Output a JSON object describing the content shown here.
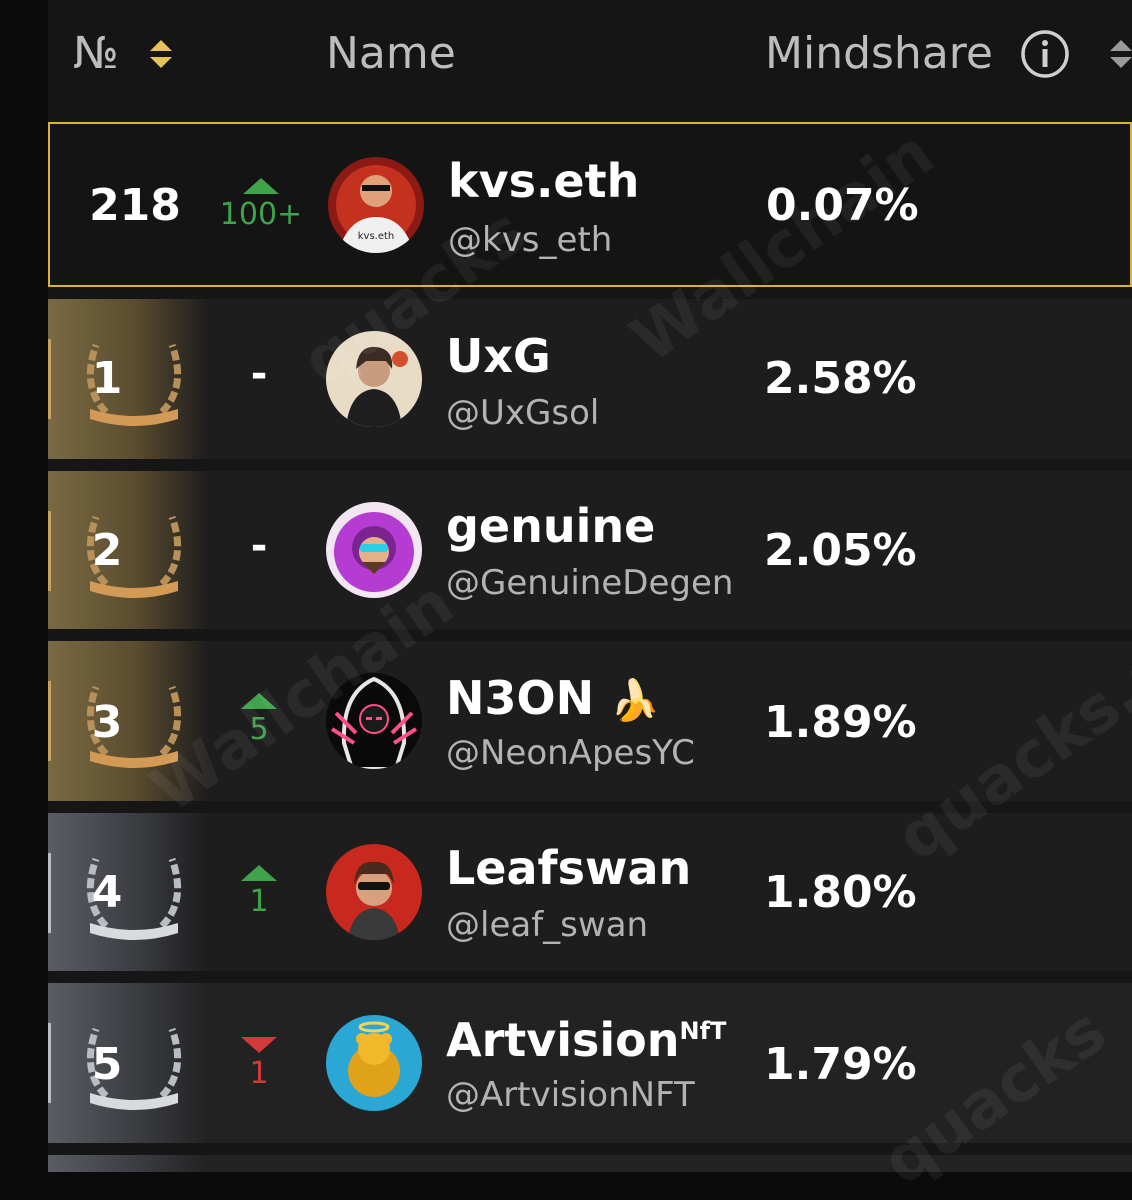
{
  "header": {
    "num_label": "№",
    "name_label": "Name",
    "mindshare_label": "Mindshare"
  },
  "rows": [
    {
      "rank": "218",
      "change": "100+",
      "change_dir": "up",
      "name": "kvs.eth",
      "handle": "@kvs_eth",
      "mindshare": "0.07%",
      "avatar_text": "kvs.eth"
    },
    {
      "rank": "1",
      "change": "-",
      "change_dir": "flat",
      "name": "UxG",
      "handle": "@UxGsol",
      "mindshare": "2.58%"
    },
    {
      "rank": "2",
      "change": "-",
      "change_dir": "flat",
      "name": "genuine",
      "handle": "@GenuineDegen",
      "mindshare": "2.05%"
    },
    {
      "rank": "3",
      "change": "5",
      "change_dir": "up",
      "name": "N3ON",
      "name_emoji": "🍌",
      "handle": "@NeonApesYC",
      "mindshare": "1.89%"
    },
    {
      "rank": "4",
      "change": "1",
      "change_dir": "up",
      "name": "Leafswan",
      "handle": "@leaf_swan",
      "mindshare": "1.80%"
    },
    {
      "rank": "5",
      "change": "1",
      "change_dir": "down",
      "name": "Artvision",
      "name_sup": "NfT",
      "handle": "@ArtvisionNFT",
      "mindshare": "1.79%"
    }
  ],
  "watermarks": [
    "Wallchain",
    "quacks",
    "quacks.app",
    "Wallchain",
    "quacks"
  ],
  "colors": {
    "highlight_border": "#d9b23b",
    "up": "#3ea34a",
    "down": "#d13a3a",
    "gold": "#c9a35c",
    "silver": "#b9bcc2"
  }
}
